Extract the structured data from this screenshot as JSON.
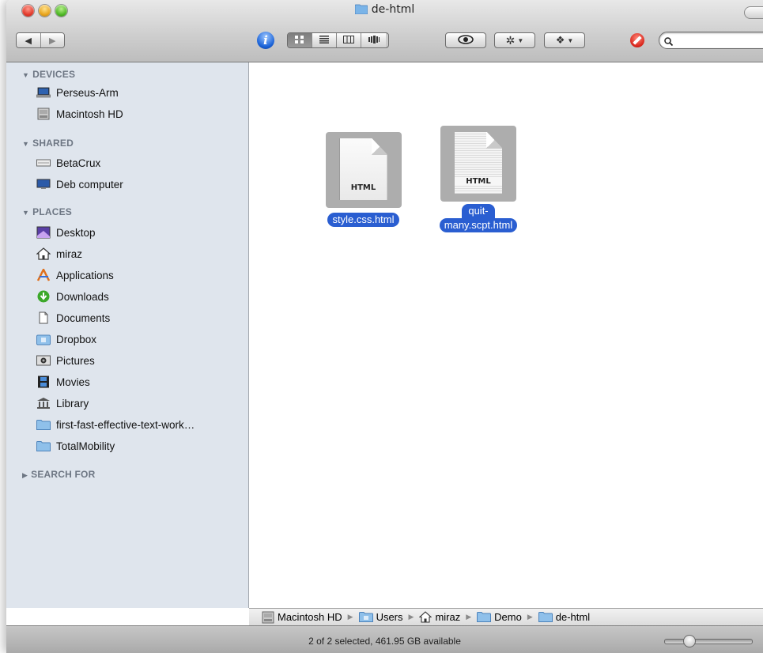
{
  "window": {
    "title": "de-html"
  },
  "toolbar": {
    "back_icon": "left-arrow",
    "forward_icon": "right-arrow",
    "info_label": "i",
    "view_modes": [
      "icon-view",
      "list-view",
      "column-view",
      "coverflow-view"
    ],
    "active_view": "icon-view",
    "quicklook_icon": "eye",
    "action_icon": "gear",
    "dropbox_icon": "dropbox",
    "search": {
      "placeholder": "",
      "value": ""
    }
  },
  "sidebar": {
    "devices": {
      "heading": "DEVICES",
      "items": [
        {
          "label": "Perseus-Arm",
          "icon": "laptop-icon"
        },
        {
          "label": "Macintosh HD",
          "icon": "hard-drive-icon"
        }
      ]
    },
    "shared": {
      "heading": "SHARED",
      "items": [
        {
          "label": "BetaCrux",
          "icon": "server-icon"
        },
        {
          "label": "Deb computer",
          "icon": "monitor-icon"
        }
      ]
    },
    "places": {
      "heading": "PLACES",
      "items": [
        {
          "label": "Desktop",
          "icon": "desktop-icon"
        },
        {
          "label": "miraz",
          "icon": "home-icon"
        },
        {
          "label": "Applications",
          "icon": "applications-icon"
        },
        {
          "label": "Downloads",
          "icon": "downloads-icon"
        },
        {
          "label": "Documents",
          "icon": "documents-icon"
        },
        {
          "label": "Dropbox",
          "icon": "dropbox-folder-icon"
        },
        {
          "label": "Pictures",
          "icon": "pictures-icon"
        },
        {
          "label": "Movies",
          "icon": "movies-icon"
        },
        {
          "label": "Library",
          "icon": "library-icon"
        },
        {
          "label": "first-fast-effective-text-work…",
          "icon": "folder-icon"
        },
        {
          "label": "TotalMobility",
          "icon": "folder-icon"
        }
      ]
    },
    "search_for": {
      "heading": "SEARCH FOR"
    }
  },
  "files": [
    {
      "name": "style.css.html",
      "type_label": "HTML",
      "selected": true
    },
    {
      "name_line1": "quit-",
      "name_line2": "many.scpt.html",
      "type_label": "HTML",
      "selected": true
    }
  ],
  "pathbar": [
    {
      "label": "Macintosh HD",
      "icon": "hard-drive-icon"
    },
    {
      "label": "Users",
      "icon": "users-folder-icon"
    },
    {
      "label": "miraz",
      "icon": "home-icon"
    },
    {
      "label": "Demo",
      "icon": "folder-icon"
    },
    {
      "label": "de-html",
      "icon": "folder-icon"
    }
  ],
  "status": {
    "text": "2 of 2 selected, 461.95 GB available"
  },
  "colors": {
    "selection": "#2a5ed1",
    "sidebar_bg": "#dfe5ed",
    "sidebar_heading": "#6d7683"
  }
}
